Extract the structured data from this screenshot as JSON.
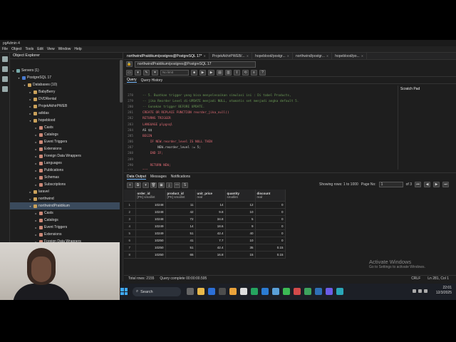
{
  "app": {
    "title": "pgAdmin 4"
  },
  "menu": [
    "File",
    "Object",
    "Tools",
    "Edit",
    "View",
    "Window",
    "Help"
  ],
  "explorer": {
    "title": "Object Explorer",
    "tree": [
      {
        "label": "Servers (1)",
        "depth": 0,
        "expanded": true,
        "color": "#7aa"
      },
      {
        "label": "PostgreSQL 17",
        "depth": 1,
        "expanded": true,
        "color": "#4a7bd0"
      },
      {
        "label": "Databases (10)",
        "depth": 2,
        "expanded": true,
        "color": "#caa15a"
      },
      {
        "label": "BabyBerry",
        "depth": 3,
        "expanded": false,
        "color": "#caa15a"
      },
      {
        "label": "DVDRental",
        "depth": 3,
        "expanded": false,
        "color": "#caa15a"
      },
      {
        "label": "ProjekAkhirPWEB",
        "depth": 3,
        "expanded": false,
        "color": "#caa15a"
      },
      {
        "label": "adidas",
        "depth": 3,
        "expanded": false,
        "color": "#caa15a"
      },
      {
        "label": "hopeblood",
        "depth": 3,
        "expanded": true,
        "color": "#caa15a"
      },
      {
        "label": "Casts",
        "depth": 4,
        "expanded": false,
        "color": "#c87"
      },
      {
        "label": "Catalogs",
        "depth": 4,
        "expanded": false,
        "color": "#c87"
      },
      {
        "label": "Event Triggers",
        "depth": 4,
        "expanded": false,
        "color": "#c87"
      },
      {
        "label": "Extensions",
        "depth": 4,
        "expanded": false,
        "color": "#c87"
      },
      {
        "label": "Foreign Data Wrappers",
        "depth": 4,
        "expanded": false,
        "color": "#c87"
      },
      {
        "label": "Languages",
        "depth": 4,
        "expanded": false,
        "color": "#c87"
      },
      {
        "label": "Publications",
        "depth": 4,
        "expanded": false,
        "color": "#c87"
      },
      {
        "label": "Schemas",
        "depth": 4,
        "expanded": false,
        "color": "#c87"
      },
      {
        "label": "Subscriptions",
        "depth": 4,
        "expanded": false,
        "color": "#c87"
      },
      {
        "label": "laravel",
        "depth": 3,
        "expanded": false,
        "color": "#caa15a"
      },
      {
        "label": "northwind",
        "depth": 3,
        "expanded": false,
        "color": "#caa15a"
      },
      {
        "label": "northwindPraktikum",
        "depth": 3,
        "expanded": true,
        "color": "#caa15a",
        "selected": true
      },
      {
        "label": "Casts",
        "depth": 4,
        "expanded": false,
        "color": "#c87"
      },
      {
        "label": "Catalogs",
        "depth": 4,
        "expanded": false,
        "color": "#c87"
      },
      {
        "label": "Event Triggers",
        "depth": 4,
        "expanded": false,
        "color": "#c87"
      },
      {
        "label": "Extensions",
        "depth": 4,
        "expanded": false,
        "color": "#c87"
      },
      {
        "label": "Foreign Data Wrappers",
        "depth": 4,
        "expanded": false,
        "color": "#c87"
      }
    ]
  },
  "tabs": [
    {
      "label": "northwindPraktikum/postgres@PostgreSQL 17*",
      "active": true
    },
    {
      "label": "ProjekAkhirPWEB/..."
    },
    {
      "label": "hopeblood/postgr..."
    },
    {
      "label": "northwind/postgr..."
    },
    {
      "label": "hopeblood/po..."
    }
  ],
  "connection": {
    "label": "northwindPraktikum/postgres@PostgreSQL 17"
  },
  "toolbar": {
    "limit": "No limit"
  },
  "query_tabs": {
    "query": "Query",
    "history": "Query History"
  },
  "scratch_pad": {
    "title": "Scratch Pad"
  },
  "editor": {
    "lines": [
      {
        "n": "278",
        "text": "-- 5. Buatkan trigger yang bisa menyelesaikan simulasi ini : Di tabel Products,",
        "cls": "c-comment"
      },
      {
        "n": "279",
        "text": "-- jika Reorder Level di-UPDATE menjadi NULL, otomatis set menjadi angka default 5.",
        "cls": "c-comment"
      },
      {
        "n": "280",
        "text": "-- Gunakan trigger BEFORE UPDATE.",
        "cls": "c-comment"
      },
      {
        "n": "281",
        "text": "CREATE OR REPLACE FUNCTION reorder_jika_null()",
        "cls": "c-kw"
      },
      {
        "n": "282",
        "text": "RETURNS TRIGGER",
        "cls": "c-kw"
      },
      {
        "n": "283",
        "text": "LANGUAGE plpgsql",
        "cls": "c-kw"
      },
      {
        "n": "284",
        "text": "AS $$",
        "cls": "c-plain"
      },
      {
        "n": "285",
        "text": "BEGIN",
        "cls": "c-kw"
      },
      {
        "n": "286",
        "text": "    IF NEW.reorder_level IS NULL THEN",
        "cls": "c-kw"
      },
      {
        "n": "287",
        "text": "        NEW.reorder_level := 5;",
        "cls": "c-plain"
      },
      {
        "n": "288",
        "text": "    END IF;",
        "cls": "c-kw"
      },
      {
        "n": "289",
        "text": "",
        "cls": "c-plain"
      },
      {
        "n": "290",
        "text": "    RETURN NEW;",
        "cls": "c-kw"
      },
      {
        "n": "291",
        "text": "END;",
        "cls": "c-kw"
      }
    ]
  },
  "data_output": {
    "tabs": {
      "output": "Data Output",
      "messages": "Messages",
      "notifications": "Notifications"
    },
    "showing": "Showing rows: 1 to 1000",
    "page_label": "Page No:",
    "page_value": "1",
    "page_total": "of 3",
    "columns": [
      {
        "name": "order_id",
        "sub": "[PK] smallint"
      },
      {
        "name": "product_id",
        "sub": "[PK] smallint"
      },
      {
        "name": "unit_price",
        "sub": "real"
      },
      {
        "name": "quantity",
        "sub": "smallint"
      },
      {
        "name": "discount",
        "sub": "real"
      }
    ],
    "rows": [
      [
        "1",
        "10248",
        "11",
        "14",
        "12",
        "0"
      ],
      [
        "2",
        "10248",
        "42",
        "9.8",
        "10",
        "0"
      ],
      [
        "3",
        "10248",
        "72",
        "34.8",
        "5",
        "0"
      ],
      [
        "4",
        "10249",
        "14",
        "18.6",
        "9",
        "0"
      ],
      [
        "5",
        "10249",
        "51",
        "42.4",
        "40",
        "0"
      ],
      [
        "6",
        "10250",
        "41",
        "7.7",
        "10",
        "0"
      ],
      [
        "7",
        "10250",
        "51",
        "42.4",
        "35",
        "0.15"
      ],
      [
        "8",
        "10250",
        "65",
        "16.8",
        "15",
        "0.15"
      ]
    ]
  },
  "status": {
    "total_rows": "Total rows: 2155",
    "query_complete": "Query complete 00:00:00.595",
    "encoding": "CRLF",
    "position": "Ln 281, Col 1"
  },
  "watermark": {
    "line1": "Activate Windows",
    "line2": "Go to Settings to activate Windows."
  },
  "taskbar": {
    "search": "Search",
    "time": "22:01",
    "date": "12/3/2025"
  }
}
